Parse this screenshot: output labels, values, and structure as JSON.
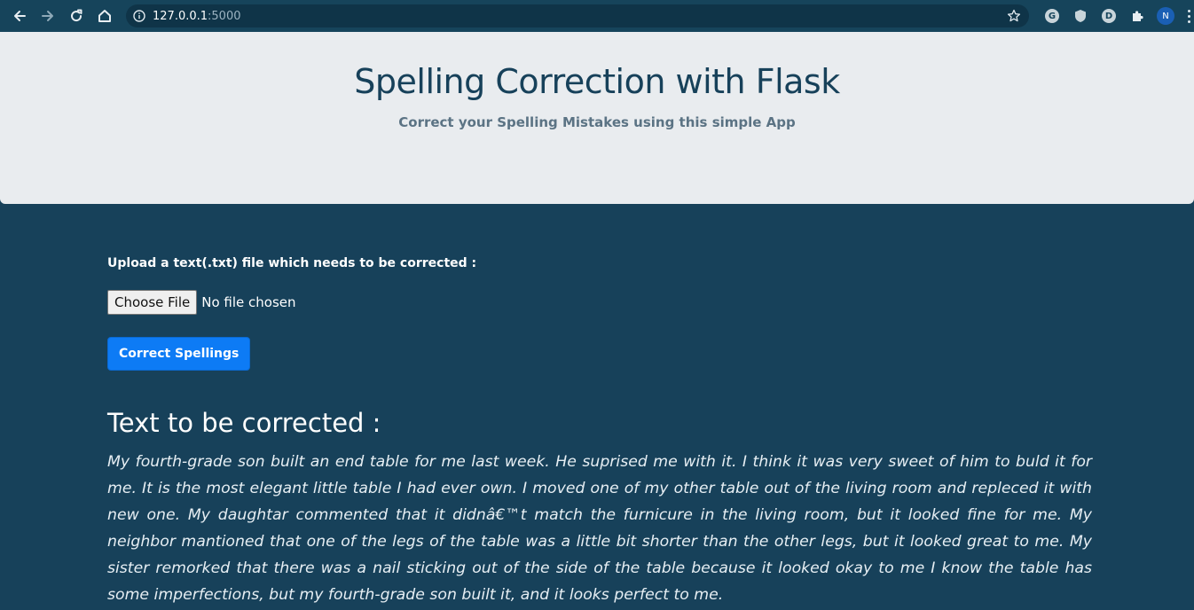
{
  "browser": {
    "url_host": "127.0.0.1",
    "url_port": ":5000",
    "profile_initial": "N",
    "extensions": [
      "G",
      "D"
    ]
  },
  "header": {
    "title": "Spelling Correction with Flask",
    "subtitle": "Correct your Spelling Mistakes using this simple App"
  },
  "form": {
    "upload_label": "Upload a text(.txt) file which needs to be corrected :",
    "choose_file_label": "Choose File",
    "file_status": "No file chosen",
    "submit_label": "Correct Spellings"
  },
  "result": {
    "heading": "Text to be corrected :",
    "text": "My fourth-grade son built an end table for me last week. He suprised me with it. I think it was very sweet of him to buld it for me. It is the most elegant little table I had ever own. I moved one of my other table out of the living room and repleced it with new one. My daughtar commented that it didnâ€™t match the furnicure in the living room, but it looked fine for me. My neighbor mantioned that one of the legs of the table was a little bit shorter than the other legs, but it looked great to me. My sister remorked that there was a nail sticking out of the side of the table because it looked okay to me I know the table has some imperfections, but my fourth-grade son built it, and it looks perfect to me."
  },
  "colors": {
    "page_background": "#17415a",
    "jumbotron_background": "#e9ecef",
    "title_color": "#17415a",
    "subtitle_color": "#5b7384",
    "primary_button": "#0d7bf5"
  },
  "icons": {
    "back": "arrow-left-icon",
    "forward": "arrow-right-icon",
    "reload": "reload-icon",
    "home": "home-icon",
    "info": "info-icon",
    "bookmark": "star-icon",
    "extension_shield": "shield-icon",
    "extensions": "puzzle-icon",
    "menu": "more-vertical-icon"
  }
}
